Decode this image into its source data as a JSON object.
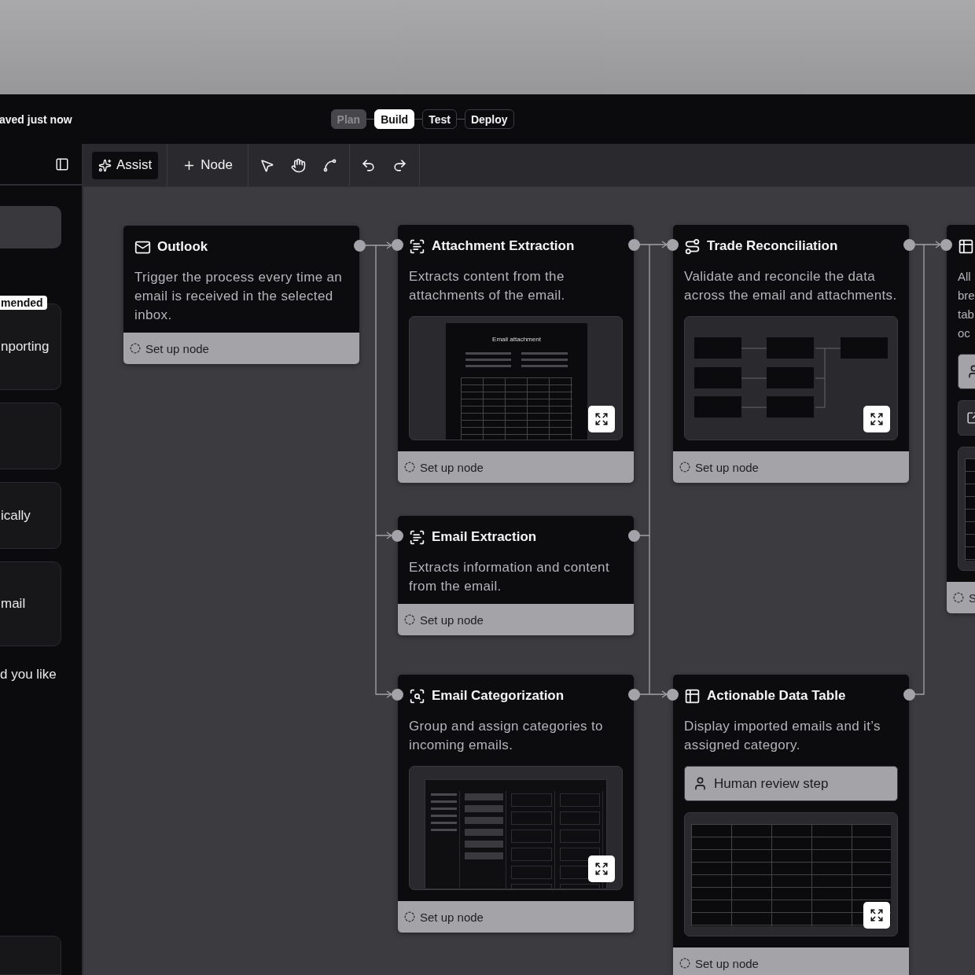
{
  "header": {
    "save_status": "aved just now",
    "steps": [
      {
        "label": "Plan",
        "selected": false,
        "disabled": true
      },
      {
        "label": "Build",
        "selected": true,
        "disabled": false
      },
      {
        "label": "Test",
        "selected": false,
        "disabled": false
      },
      {
        "label": "Deploy",
        "selected": false,
        "disabled": false
      }
    ]
  },
  "toolbar": {
    "assist": "Assist",
    "add_node": "Node"
  },
  "sidebar": {
    "badge": "mended",
    "cards": [
      {
        "kind": "text",
        "text": "nporting"
      },
      {
        "kind": "empty"
      },
      {
        "kind": "text",
        "text": "ically"
      },
      {
        "kind": "text",
        "text": "mail"
      }
    ],
    "prompt": "d you like"
  },
  "nodes": [
    {
      "kind": "trigger",
      "title": "Outlook",
      "description": [
        "Trigger the process every time an email is received in the selected inbox."
      ],
      "footer": "Set up node"
    },
    {
      "kind": "step",
      "title": "Attachment Extraction",
      "description": [
        "Extracts content from the attachments of the email."
      ],
      "preview": {
        "kind": "document",
        "title": "Email attachment"
      },
      "footer": "Set up node"
    },
    {
      "kind": "step",
      "title": "Trade Reconciliation",
      "description": [
        "Validate and reconcile the data across the email and attachments."
      ],
      "preview": {
        "kind": "flow"
      },
      "footer": "Set up node"
    },
    {
      "kind": "step",
      "title": "Email Extraction",
      "description": [
        "Extracts information and content from the email."
      ],
      "footer": "Set up node"
    },
    {
      "kind": "step",
      "title": "Email Categorization",
      "description": [
        "Group and assign categories to incoming emails."
      ],
      "preview": {
        "kind": "app"
      },
      "footer": "Set up node"
    },
    {
      "kind": "step",
      "title": "Actionable Data Table",
      "description": [
        "Display imported emails and it’s assigned category."
      ],
      "actions": [
        {
          "kind": "review",
          "label": "Human review step"
        }
      ],
      "preview": {
        "kind": "table"
      },
      "footer": "Set up node"
    },
    {
      "kind": "step",
      "description": [
        "All",
        "bre",
        "tab",
        "oc"
      ],
      "actions": [
        {
          "kind": "review"
        },
        {
          "kind": "external"
        }
      ],
      "preview": {
        "kind": "table"
      },
      "footer": "S"
    }
  ]
}
